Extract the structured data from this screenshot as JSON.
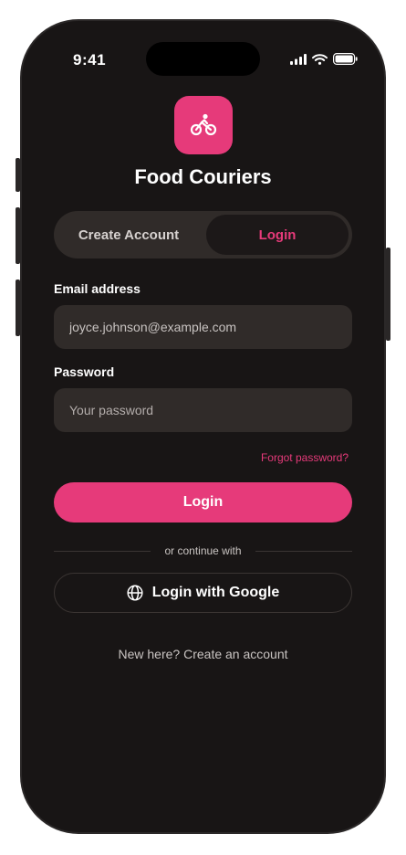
{
  "status_bar": {
    "time": "9:41",
    "icons": [
      "cellular-signal-icon",
      "wifi-icon",
      "battery-icon"
    ]
  },
  "app": {
    "icon": "bicycle-icon",
    "title": "Food Couriers"
  },
  "auth_tabs": {
    "create_label": "Create Account",
    "login_label": "Login",
    "active": "Login"
  },
  "form": {
    "email_label": "Email address",
    "email_value": "joyce.johnson@example.com",
    "password_label": "Password",
    "password_placeholder": "Your password",
    "forgot_label": "Forgot password?",
    "submit_label": "Login"
  },
  "alt_login": {
    "divider_text": "or continue with",
    "google_icon": "globe-icon",
    "google_label": "Login with Google"
  },
  "footer": {
    "signup_text": "New here? Create an account"
  },
  "colors": {
    "accent": "#e63a7a",
    "background": "#181515",
    "surface": "#302b29"
  }
}
